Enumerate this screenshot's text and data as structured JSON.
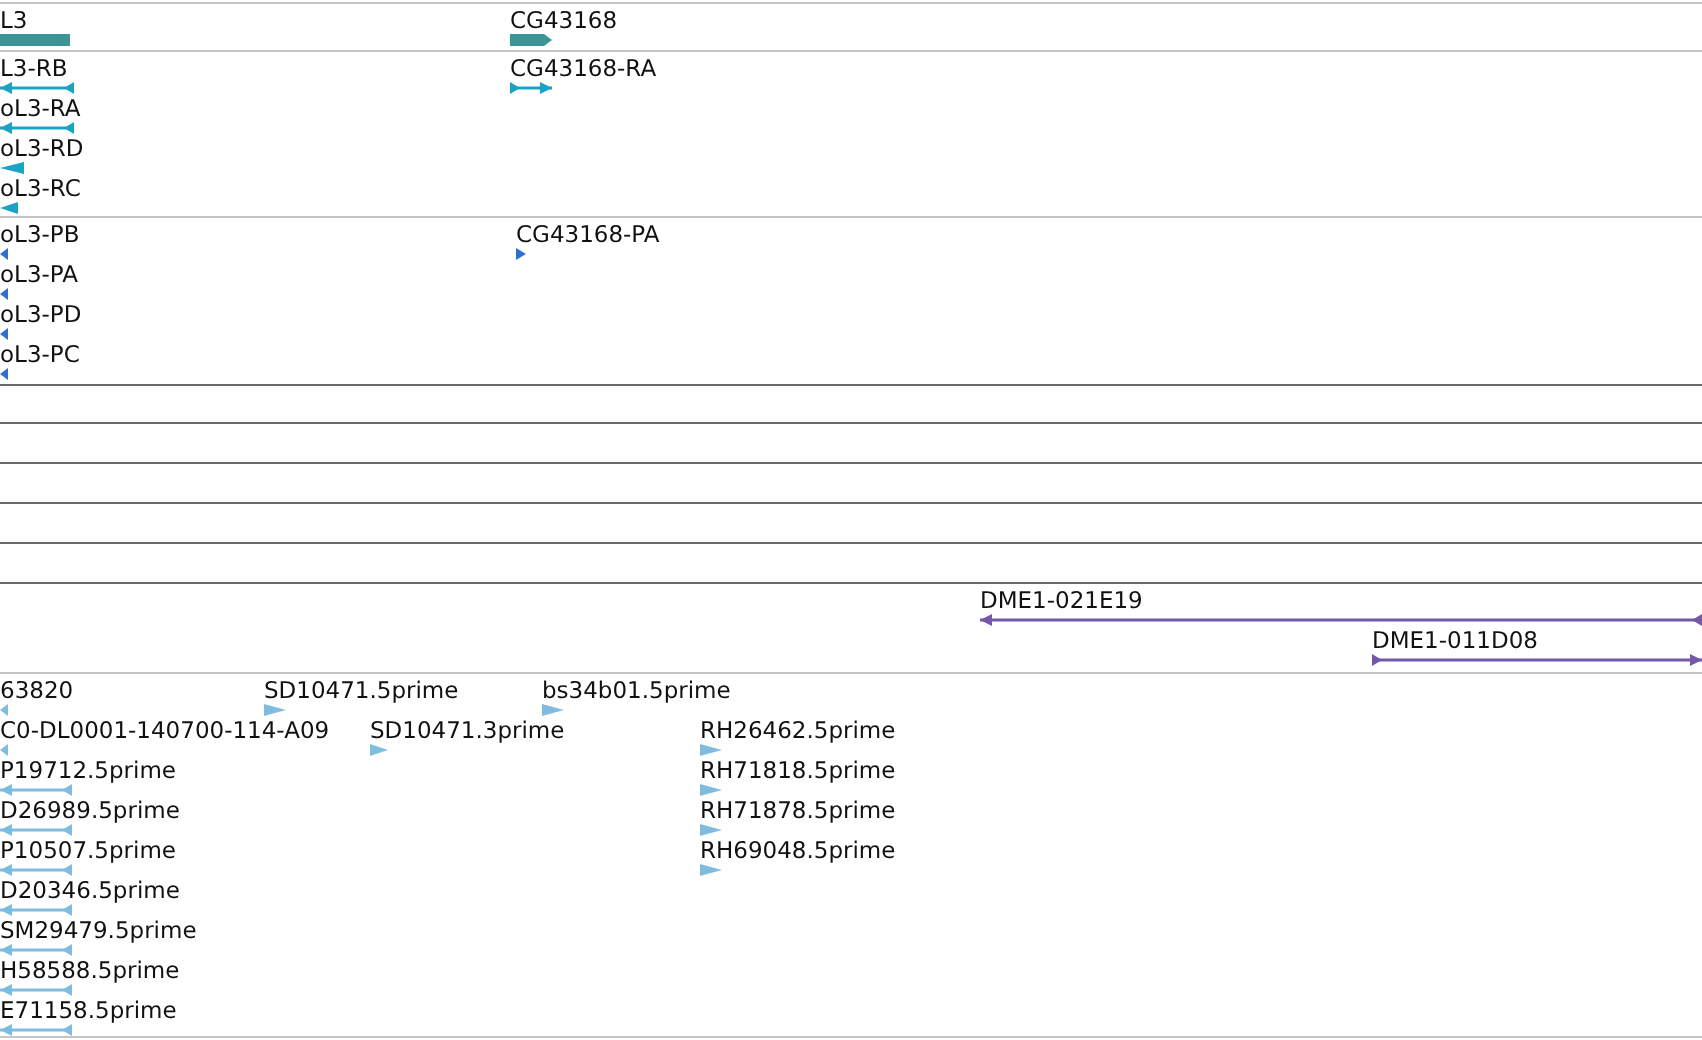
{
  "tracks": [
    {
      "kind": "gene",
      "features": [
        {
          "label": "L3",
          "reverse": true
        },
        {
          "label": "CG43168",
          "reverse": false
        }
      ]
    },
    {
      "kind": "transcript",
      "features": [
        {
          "label": "L3-RB",
          "reverse": true
        },
        {
          "label": "oL3-RA",
          "reverse": true
        },
        {
          "label": "oL3-RD",
          "reverse": true
        },
        {
          "label": "oL3-RC",
          "reverse": true
        },
        {
          "label": "CG43168-RA",
          "reverse": false
        }
      ]
    },
    {
      "kind": "protein",
      "features": [
        {
          "label": "oL3-PB",
          "reverse": true
        },
        {
          "label": "oL3-PA",
          "reverse": true
        },
        {
          "label": "oL3-PD",
          "reverse": true
        },
        {
          "label": "oL3-PC",
          "reverse": true
        },
        {
          "label": "CG43168-PA",
          "reverse": false
        }
      ]
    },
    {
      "kind": "empty"
    },
    {
      "kind": "empty"
    },
    {
      "kind": "empty"
    },
    {
      "kind": "empty"
    },
    {
      "kind": "empty"
    },
    {
      "kind": "clone",
      "features": [
        {
          "label": "DME1-021E19",
          "reverse": true
        },
        {
          "label": "DME1-011D08",
          "reverse": false
        }
      ]
    },
    {
      "kind": "est",
      "features": [
        {
          "label": "63820",
          "reverse": true
        },
        {
          "label": "C0-DL0001-140700-114-A09",
          "reverse": true
        },
        {
          "label": "P19712.5prime",
          "reverse": true
        },
        {
          "label": "D26989.5prime",
          "reverse": true
        },
        {
          "label": "P10507.5prime",
          "reverse": true
        },
        {
          "label": "D20346.5prime",
          "reverse": true
        },
        {
          "label": "SM29479.5prime",
          "reverse": true
        },
        {
          "label": "H58588.5prime",
          "reverse": true
        },
        {
          "label": "E71158.5prime",
          "reverse": true
        },
        {
          "label": "SD10471.5prime",
          "reverse": false
        },
        {
          "label": "SD10471.3prime",
          "reverse": false
        },
        {
          "label": "bs34b01.5prime",
          "reverse": false
        },
        {
          "label": "RH26462.5prime",
          "reverse": false
        },
        {
          "label": "RH71818.5prime",
          "reverse": false
        },
        {
          "label": "RH71878.5prime",
          "reverse": false
        },
        {
          "label": "RH69048.5prime",
          "reverse": false
        }
      ]
    }
  ]
}
